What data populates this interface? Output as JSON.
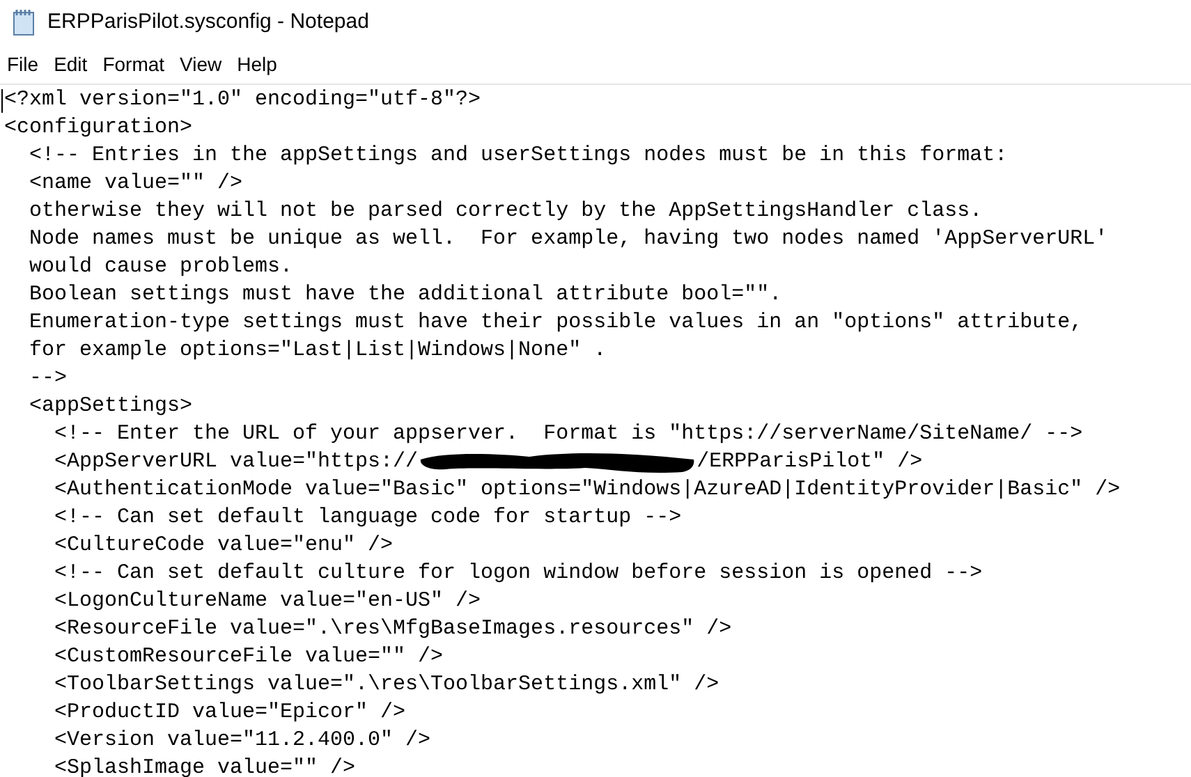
{
  "window": {
    "title": "ERPParisPilot.sysconfig - Notepad"
  },
  "menu": [
    "File",
    "Edit",
    "Format",
    "View",
    "Help"
  ],
  "editor": {
    "lines": [
      {
        "kind": "text",
        "text": "<?xml version=\"1.0\" encoding=\"utf-8\"?>"
      },
      {
        "kind": "text",
        "text": "<configuration>"
      },
      {
        "kind": "text",
        "text": "  <!-- Entries in the appSettings and userSettings nodes must be in this format:"
      },
      {
        "kind": "text",
        "text": "  <name value=\"\" />"
      },
      {
        "kind": "text",
        "text": "  otherwise they will not be parsed correctly by the AppSettingsHandler class."
      },
      {
        "kind": "text",
        "text": "  Node names must be unique as well.  For example, having two nodes named 'AppServerURL'"
      },
      {
        "kind": "text",
        "text": "  would cause problems."
      },
      {
        "kind": "text",
        "text": "  Boolean settings must have the additional attribute bool=\"\"."
      },
      {
        "kind": "text",
        "text": "  Enumeration-type settings must have their possible values in an \"options\" attribute,"
      },
      {
        "kind": "text",
        "text": "  for example options=\"Last|List|Windows|None\" ."
      },
      {
        "kind": "text",
        "text": "  -->"
      },
      {
        "kind": "text",
        "text": "  <appSettings>"
      },
      {
        "kind": "text",
        "text": "    <!-- Enter the URL of your appserver.  Format is \"https://serverName/SiteName/ -->"
      },
      {
        "kind": "redacted",
        "before": "    <AppServerURL value=\"https://",
        "after": "/ERPParisPilot\" />"
      },
      {
        "kind": "text",
        "text": "    <AuthenticationMode value=\"Basic\" options=\"Windows|AzureAD|IdentityProvider|Basic\" />"
      },
      {
        "kind": "text",
        "text": "    <!-- Can set default language code for startup -->"
      },
      {
        "kind": "text",
        "text": "    <CultureCode value=\"enu\" />"
      },
      {
        "kind": "text",
        "text": "    <!-- Can set default culture for logon window before session is opened -->"
      },
      {
        "kind": "text",
        "text": "    <LogonCultureName value=\"en-US\" />"
      },
      {
        "kind": "text",
        "text": "    <ResourceFile value=\".\\res\\MfgBaseImages.resources\" />"
      },
      {
        "kind": "text",
        "text": "    <CustomResourceFile value=\"\" />"
      },
      {
        "kind": "text",
        "text": "    <ToolbarSettings value=\".\\res\\ToolbarSettings.xml\" />"
      },
      {
        "kind": "text",
        "text": "    <ProductID value=\"Epicor\" />"
      },
      {
        "kind": "text",
        "text": "    <Version value=\"11.2.400.0\" />"
      },
      {
        "kind": "text",
        "text": "    <SplashImage value=\"\" />"
      }
    ]
  }
}
